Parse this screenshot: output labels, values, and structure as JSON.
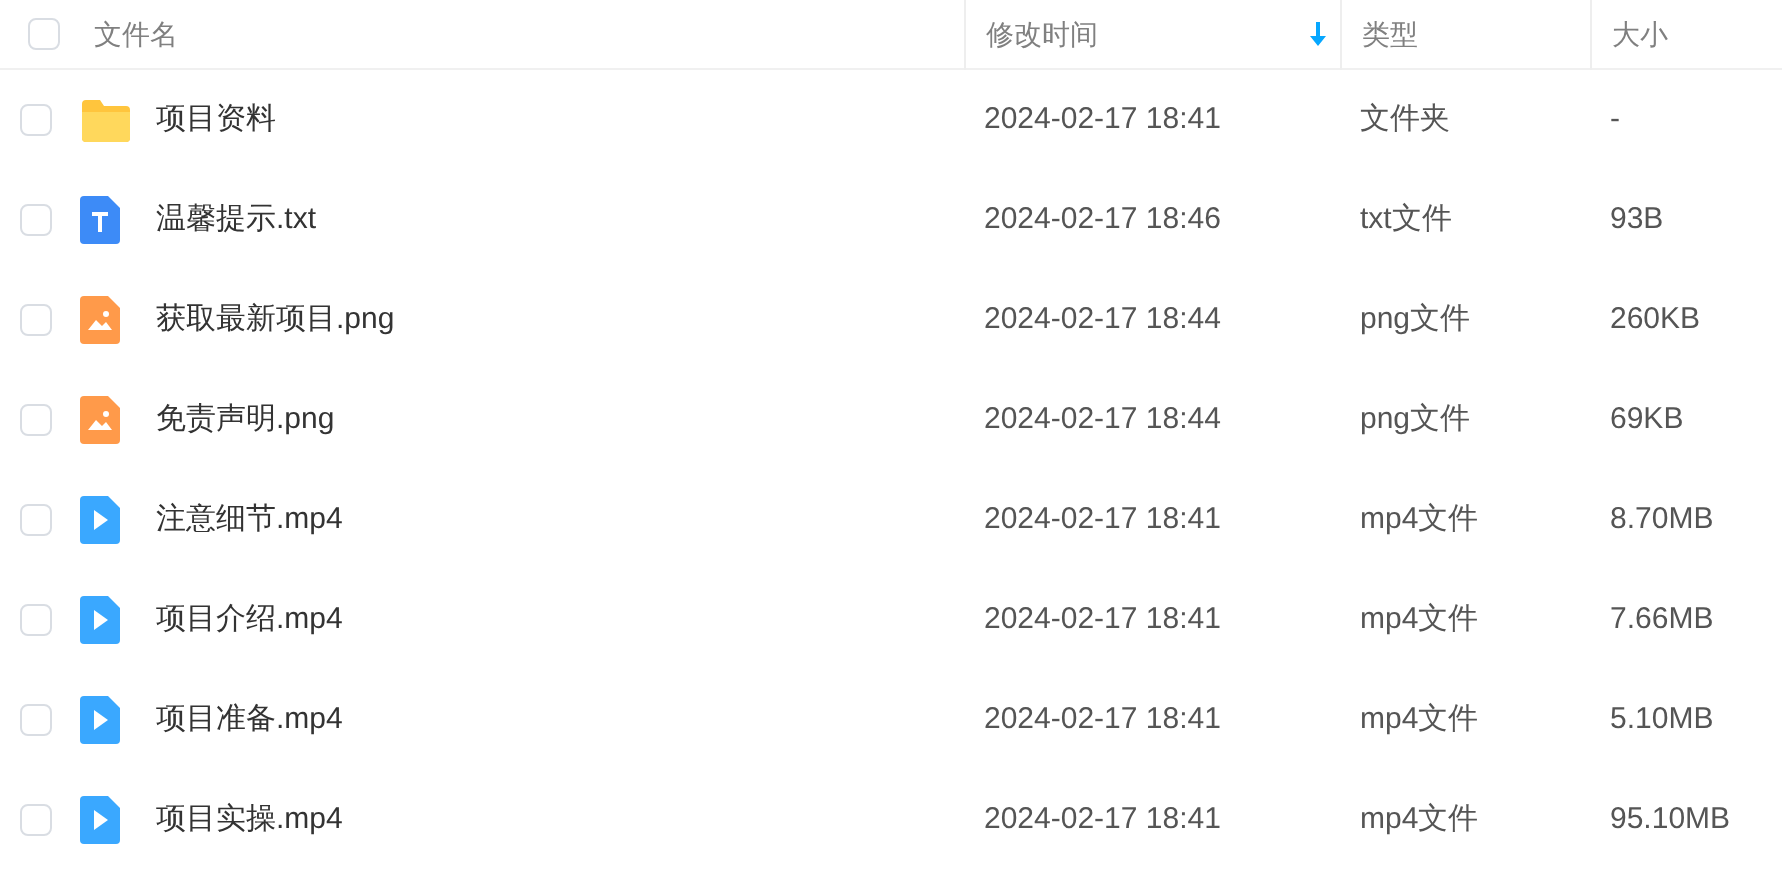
{
  "header": {
    "checked": false,
    "columns": [
      {
        "label": "文件名",
        "sorted": false
      },
      {
        "label": "修改时间",
        "sorted": true
      },
      {
        "label": "类型",
        "sorted": false
      },
      {
        "label": "大小",
        "sorted": false
      }
    ]
  },
  "rows": [
    {
      "kind": "folder",
      "name": "项目资料",
      "modified": "2024-02-17 18:41",
      "type": "文件夹",
      "size": "-",
      "checked": false
    },
    {
      "kind": "text",
      "name": "温馨提示.txt",
      "modified": "2024-02-17 18:46",
      "type": "txt文件",
      "size": "93B",
      "checked": false
    },
    {
      "kind": "image",
      "name": "获取最新项目.png",
      "modified": "2024-02-17 18:44",
      "type": "png文件",
      "size": "260KB",
      "checked": false
    },
    {
      "kind": "image",
      "name": "免责声明.png",
      "modified": "2024-02-17 18:44",
      "type": "png文件",
      "size": "69KB",
      "checked": false
    },
    {
      "kind": "video",
      "name": "注意细节.mp4",
      "modified": "2024-02-17 18:41",
      "type": "mp4文件",
      "size": "8.70MB",
      "checked": false
    },
    {
      "kind": "video",
      "name": "项目介绍.mp4",
      "modified": "2024-02-17 18:41",
      "type": "mp4文件",
      "size": "7.66MB",
      "checked": false
    },
    {
      "kind": "video",
      "name": "项目准备.mp4",
      "modified": "2024-02-17 18:41",
      "type": "mp4文件",
      "size": "5.10MB",
      "checked": false
    },
    {
      "kind": "video",
      "name": "项目实操.mp4",
      "modified": "2024-02-17 18:41",
      "type": "mp4文件",
      "size": "95.10MB",
      "checked": false
    }
  ]
}
